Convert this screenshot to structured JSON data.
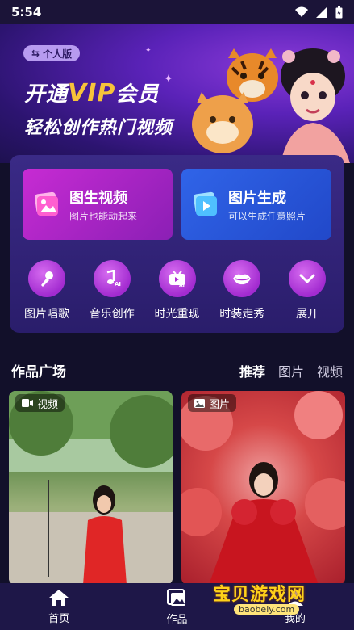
{
  "status_bar": {
    "time": "5:54"
  },
  "banner": {
    "edition_badge": "个人版",
    "vip_prefix": "开通",
    "vip_word": "VIP",
    "vip_suffix": "会员",
    "subtitle": "轻松创作热门视频"
  },
  "cards": [
    {
      "title": "图生视频",
      "subtitle": "图片也能动起来",
      "icon": "image-video-icon"
    },
    {
      "title": "图片生成",
      "subtitle": "可以生成任意照片",
      "icon": "image-play-icon"
    }
  ],
  "tools": [
    {
      "label": "图片唱歌",
      "icon": "microphone-icon"
    },
    {
      "label": "音乐创作",
      "icon": "music-note-icon"
    },
    {
      "label": "时光重现",
      "icon": "tv-ai-icon"
    },
    {
      "label": "时装走秀",
      "icon": "lips-icon"
    },
    {
      "label": "展开",
      "icon": "chevron-down-icon"
    }
  ],
  "gallery": {
    "title": "作品广场",
    "tabs": [
      "推荐",
      "图片",
      "视频"
    ],
    "active_tab": "推荐",
    "items": [
      {
        "tag": "视频",
        "tag_icon": "video-icon"
      },
      {
        "tag": "图片",
        "tag_icon": "image-icon"
      }
    ]
  },
  "bottom_nav": [
    {
      "label": "首页",
      "icon": "home-icon"
    },
    {
      "label": "作品",
      "icon": "gallery-icon"
    },
    {
      "label": "我的",
      "icon": "user-icon"
    }
  ],
  "watermark": {
    "text": "宝贝游戏网",
    "url": "baobeiy.com"
  },
  "colors": {
    "accent_gold": "#f7c33a",
    "card_video": "#c72bd3",
    "card_image": "#3064e8",
    "background": "#12102a"
  }
}
